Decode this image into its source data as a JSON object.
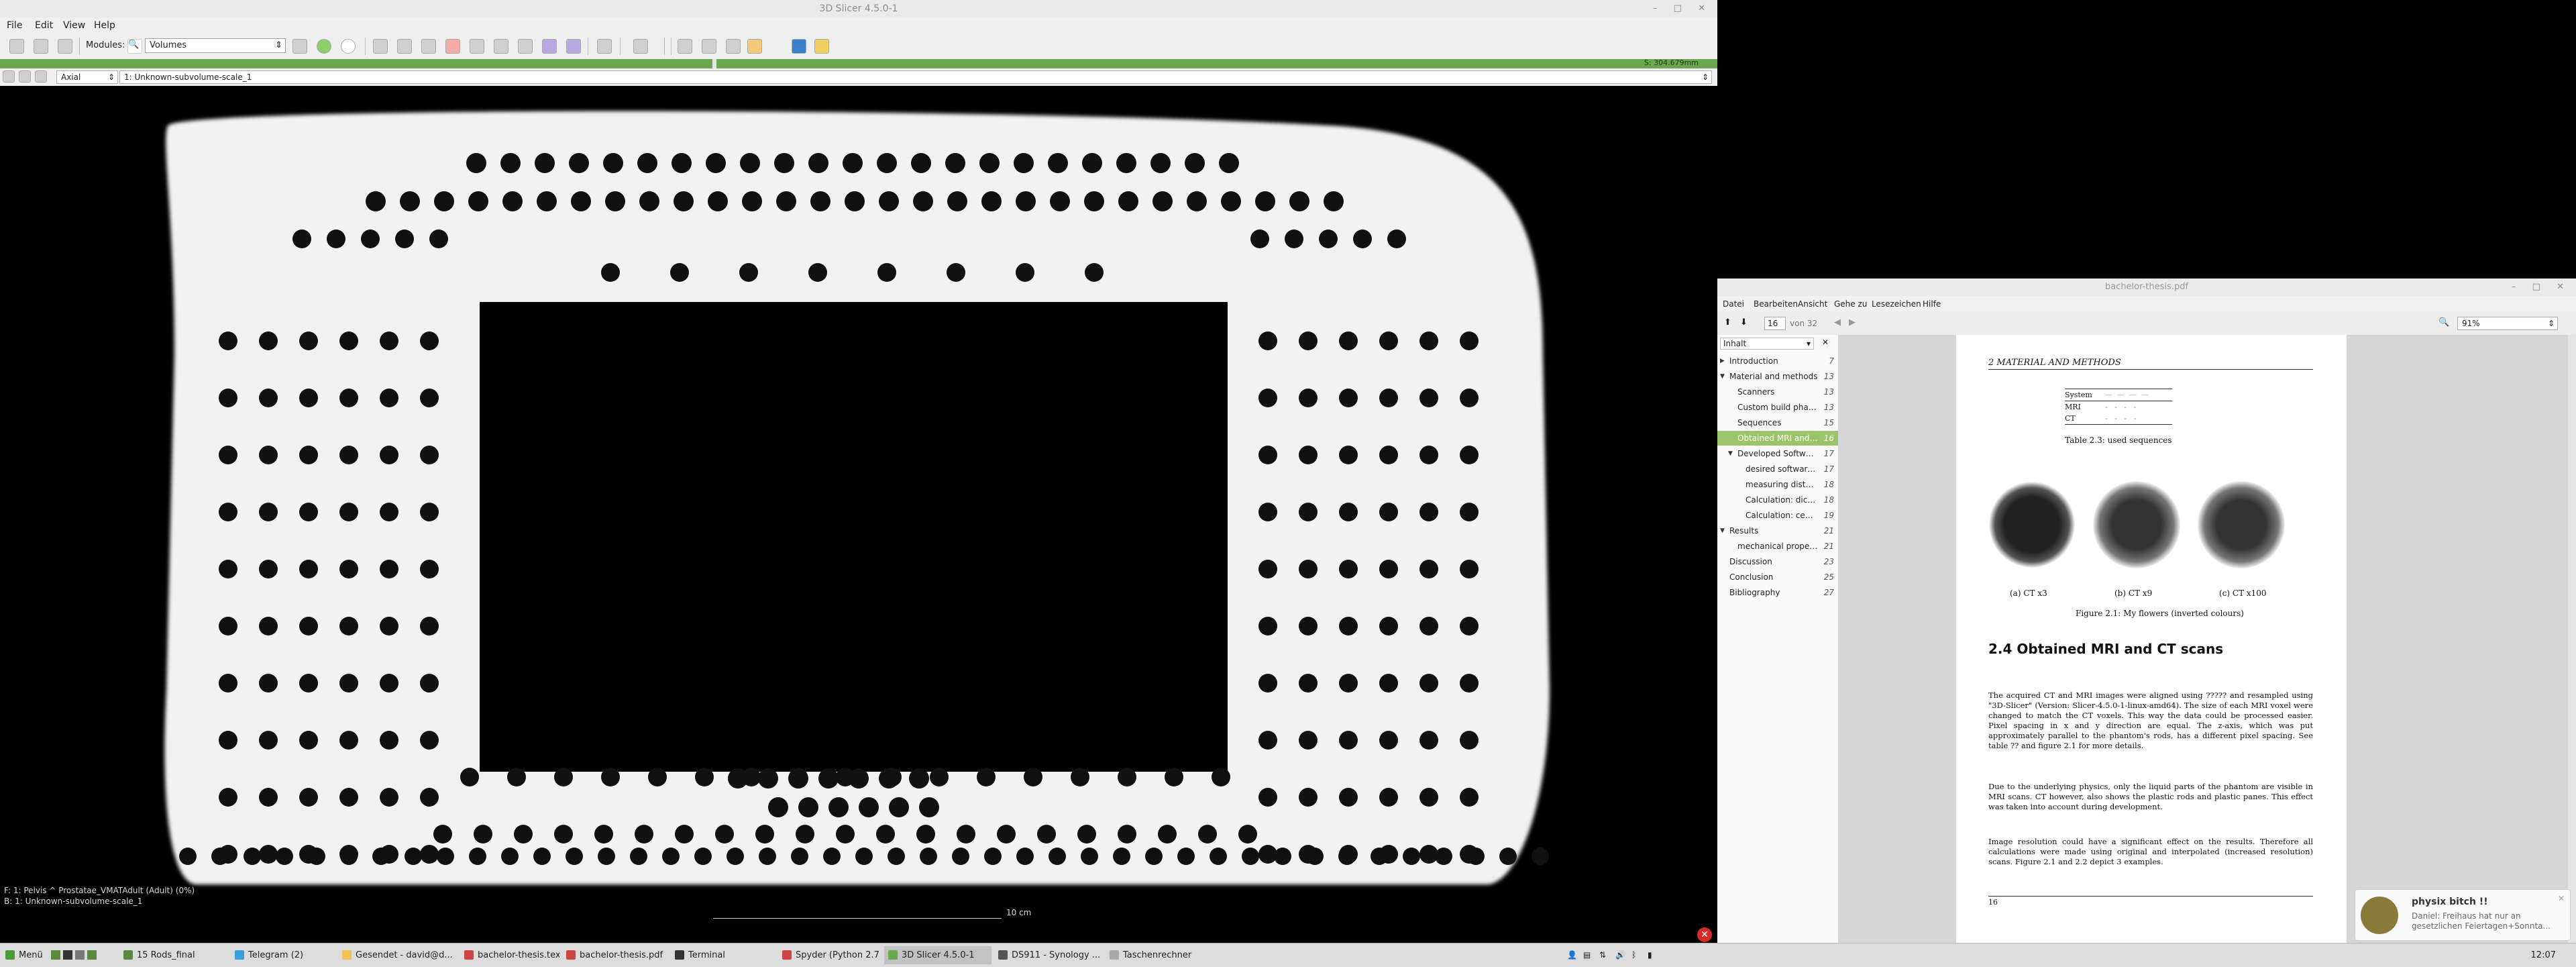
{
  "slicer": {
    "title": "3D Slicer 4.5.0-1",
    "menu": [
      "File",
      "Edit",
      "View",
      "Help"
    ],
    "modules_label": "Modules:",
    "module_selected": "Volumes",
    "green_bar_value": "S: 304.679mm",
    "orientation": "Axial",
    "volume_name": "1: Unknown-subvolume-scale_1",
    "overlay_line1": "F: 1: Pelvis ^ Prostatae_VMATAdult (Adult) (0%)",
    "overlay_line2": "B: 1: Unknown-subvolume-scale_1",
    "scale_label": "10 cm"
  },
  "pdf": {
    "title": "bachelor-thesis.pdf",
    "menu": [
      "Datei",
      "Bearbeiten",
      "Ansicht",
      "Gehe zu",
      "Lesezeichen",
      "Hilfe"
    ],
    "page_current": "16",
    "page_total": "von 32",
    "zoom": "91%",
    "sidebar_title": "Inhalt",
    "toc": [
      {
        "label": "Introduction",
        "page": "7"
      },
      {
        "label": "Material and methods",
        "page": "13"
      },
      {
        "label": "Scanners",
        "page": "13"
      },
      {
        "label": "Custom build phant...",
        "page": "13"
      },
      {
        "label": "Sequences",
        "page": "15"
      },
      {
        "label": "Obtained MRI and C...",
        "page": "16"
      },
      {
        "label": "Developed Softwar...",
        "page": "17"
      },
      {
        "label": "desired software ...",
        "page": "17"
      },
      {
        "label": "measuring distort...",
        "page": "18"
      },
      {
        "label": "Calculation: dice-...",
        "page": "18"
      },
      {
        "label": "Calculation: cente...",
        "page": "19"
      },
      {
        "label": "Results",
        "page": "21"
      },
      {
        "label": "mechanical properti...",
        "page": "21"
      },
      {
        "label": "Discussion",
        "page": "23"
      },
      {
        "label": "Conclusion",
        "page": "25"
      },
      {
        "label": "Bibliography",
        "page": "27"
      }
    ],
    "page": {
      "header": "2  MATERIAL AND METHODS",
      "table_col": "System",
      "table_rows": [
        "MRI",
        "CT"
      ],
      "table_caption": "Table 2.3: used sequences",
      "sub_captions": [
        "(a) CT x3",
        "(b) CT x9",
        "(c) CT x100"
      ],
      "figure_caption": "Figure 2.1: My flowers (inverted colours)",
      "section_title": "2.4  Obtained MRI and CT scans",
      "para1": "The acquired CT and MRI images were aligned using ????? and resampled using \"3D-Slicer\" (Version: Slicer-4.5.0-1-linux-amd64). The size of each MRI voxel were changed to match the CT voxels. This way the data could be processed easier. Pixel spacing in x and y direction are equal. The z-axis, which was put approximately parallel to the phantom's rods, has a different pixel spacing. See table ?? and figure 2.1 for more details.",
      "para2": "Due to the underlying physics, only the liquid parts of the phantom are visible in MRI scans. CT however, also shows the plastic rods and plastic panes. This effect was taken into account during development.",
      "para3": "Image resolution could have a significant effect on the results. Therefore all calculations were made using original and interpolated (increased resolution) scans. Figure 2.1 and 2.2 depict 3 examples.",
      "page_number": "16"
    }
  },
  "taskbar": {
    "menu": "Menü",
    "tasks": [
      "15 Rods_final",
      "Telegram (2)",
      "Gesendet - david@d...",
      "bachelor-thesis.tex...",
      "bachelor-thesis.pdf",
      "Terminal",
      "Spyder (Python 2.7)",
      "3D Slicer 4.5.0-1",
      "DS911 - Synology ...",
      "Taschenrechner"
    ],
    "active_index": 7,
    "clock": "12:07"
  },
  "notification": {
    "title": "physix bitch !!",
    "body": "Daniel: Freihaus hat nur an gesetzlichen Feiertagen+Sonnta..."
  },
  "colors": {
    "accent_green": "#6aa84f",
    "toc_selected": "#9bc46a",
    "close_red": "#d62b2b"
  }
}
